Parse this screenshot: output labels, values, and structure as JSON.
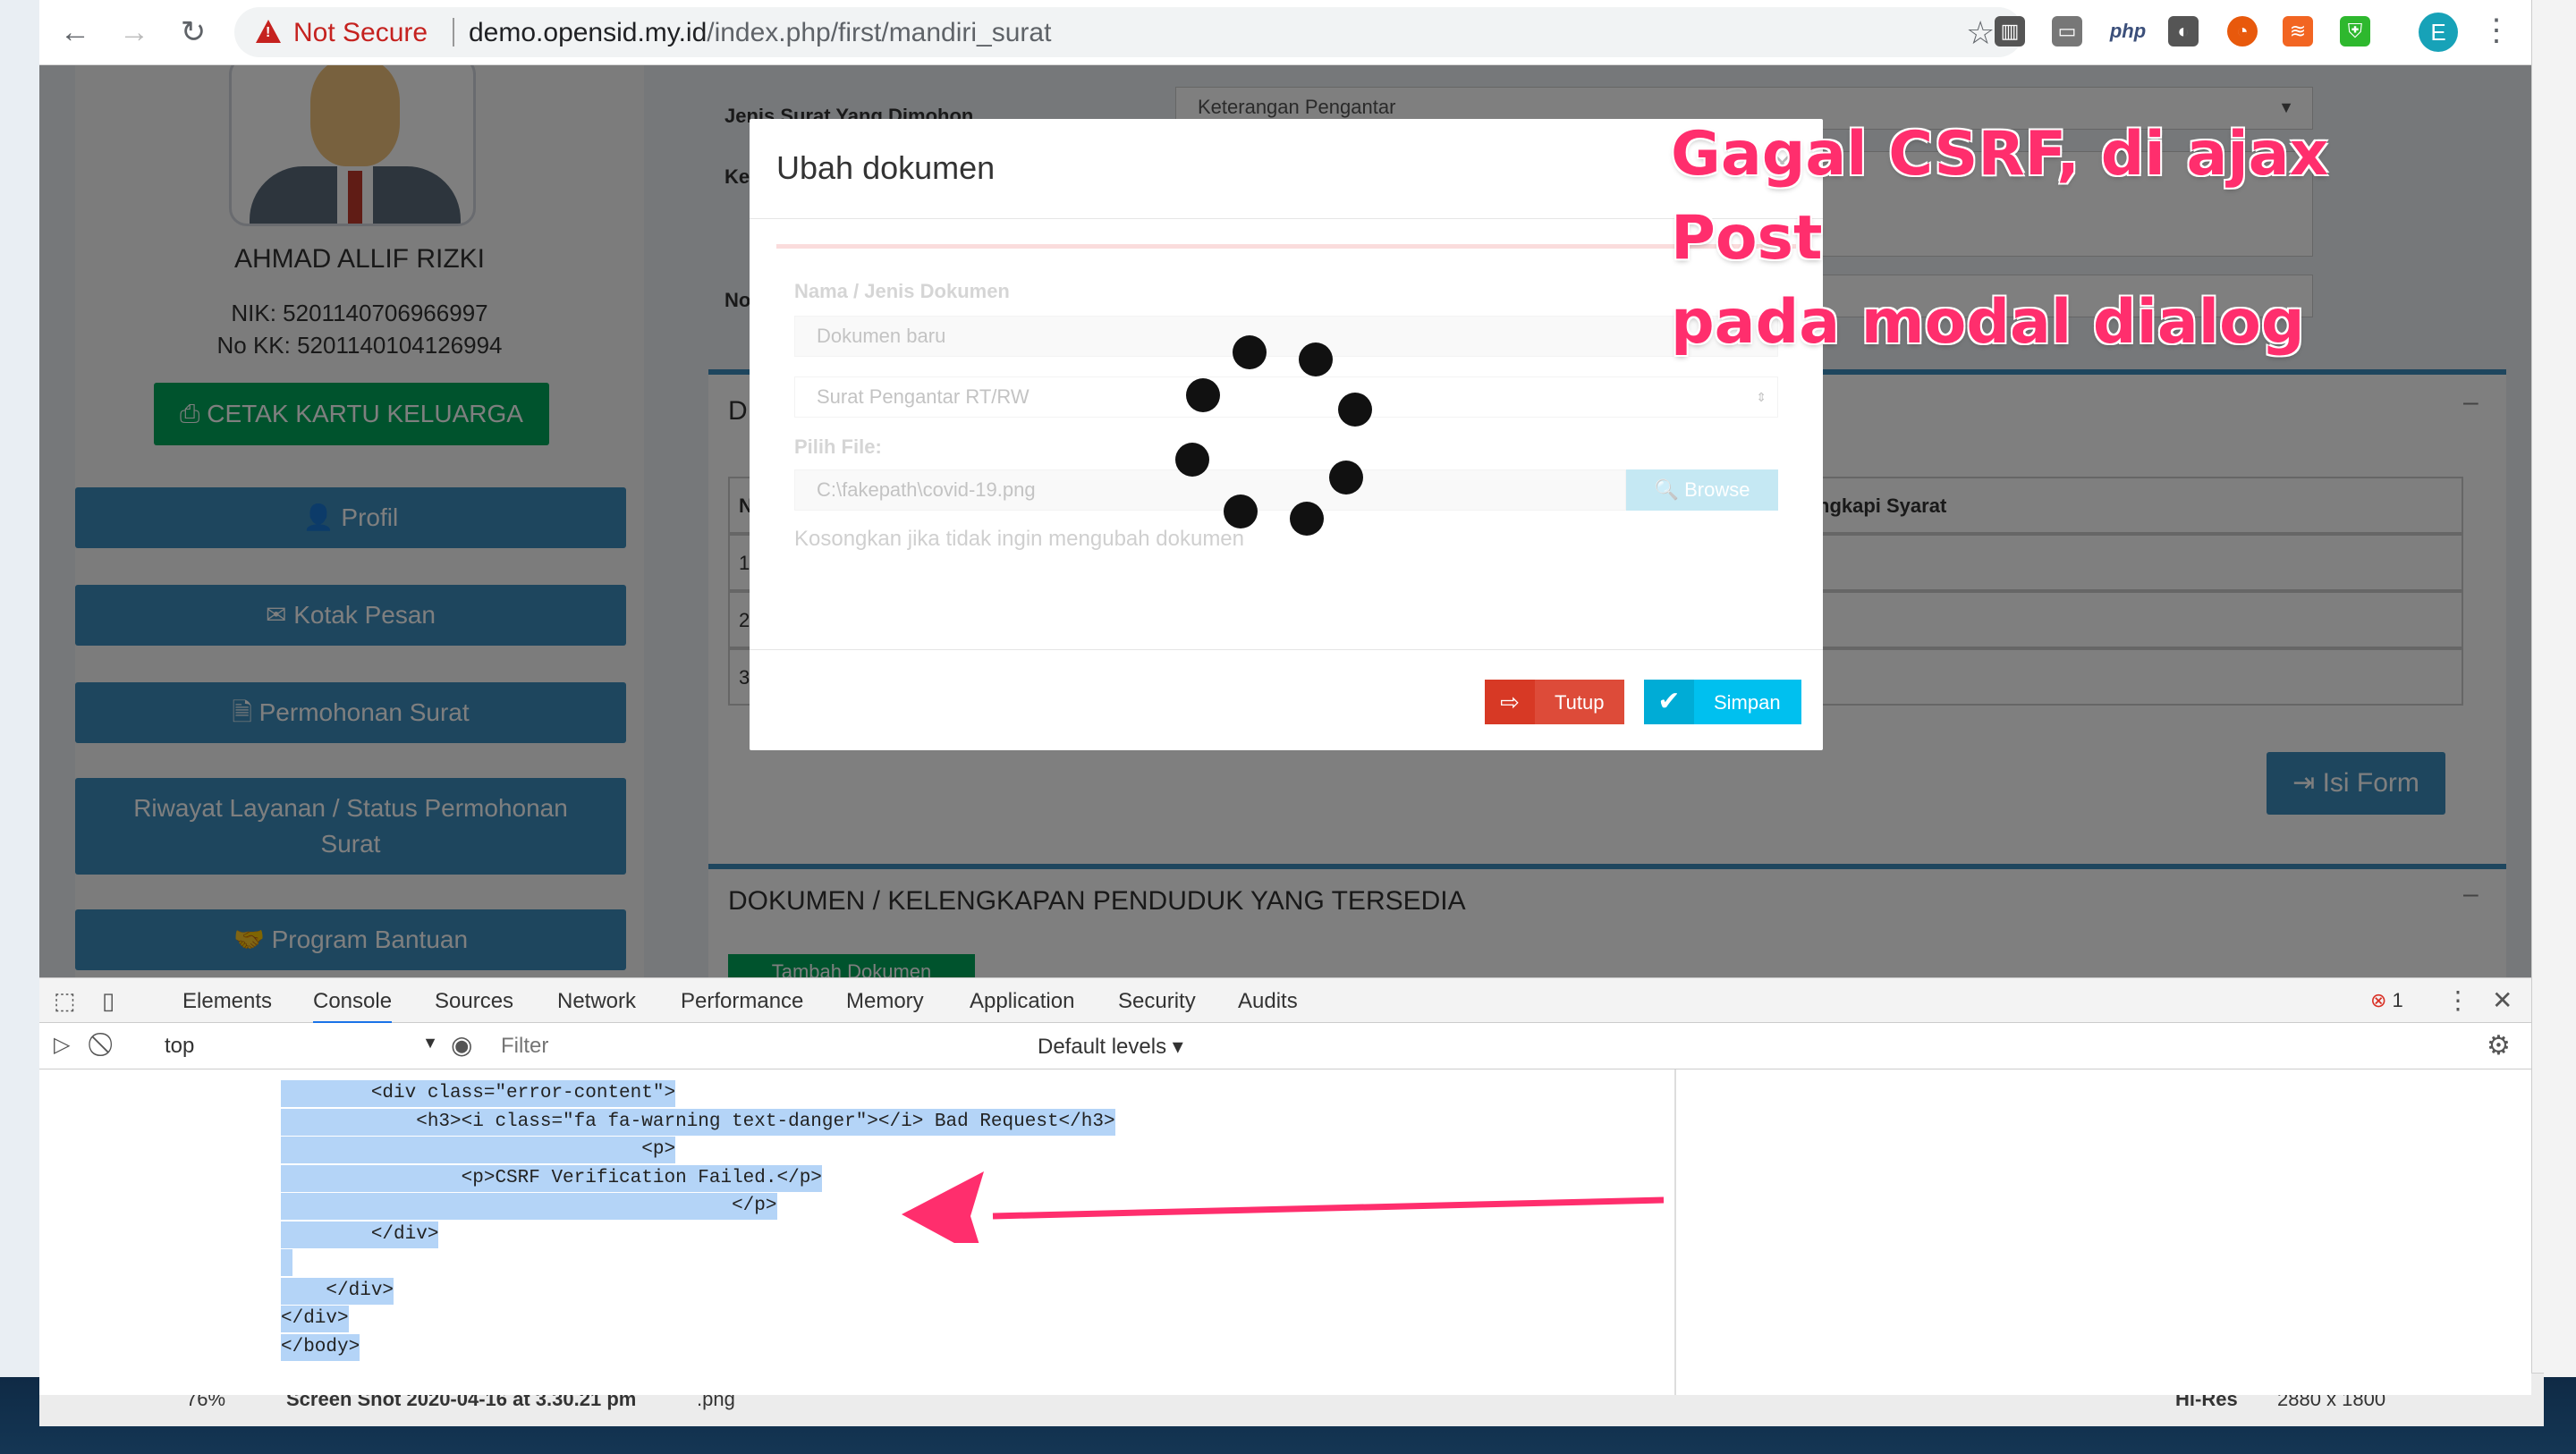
{
  "browser": {
    "security_label": "Not Secure",
    "url_domain": "demo.opensid.my.id",
    "url_path": "/index.php/first/mandiri_surat",
    "avatar_letter": "E",
    "ext_php": "php"
  },
  "sidebar": {
    "user_name": "AHMAD ALLIF RIZKI",
    "nik": "NIK: 5201140706966997",
    "no_kk": "No KK: 5201140104126994",
    "cetak_label": "CETAK KARTU KELUARGA",
    "menu": [
      {
        "label": "Profil",
        "icon": "user-icon"
      },
      {
        "label": "Kotak Pesan",
        "icon": "envelope-icon"
      },
      {
        "label": "Permohonan Surat",
        "icon": "file-icon"
      },
      {
        "label": "Riwayat Layanan / Status Permohonan Surat",
        "icon": "history-icon"
      },
      {
        "label": "Program Bantuan",
        "icon": "handshake-icon"
      }
    ]
  },
  "main": {
    "jenis_label": "Jenis Surat Yang Dimohon",
    "jenis_value": "Keterangan Pengantar",
    "ket_label": "Ke",
    "no_label": "No",
    "box1_title": "D",
    "table_header_right": "ngkapi Syarat",
    "table_header_left": "N",
    "row_nums": [
      "1",
      "2",
      "3"
    ],
    "isi_form_label": "Isi Form",
    "box2_title": "DOKUMEN / KELENGKAPAN PENDUDUK YANG TERSEDIA",
    "tambah_label": "Tambah Dokumen",
    "collapse_label": "–"
  },
  "modal": {
    "title": "Ubah dokumen",
    "close": "×",
    "nama_label": "Nama / Jenis Dokumen",
    "nama_value": "Dokumen baru",
    "jenis_select": "Surat Pengantar RT/RW",
    "file_label": "Pilih File:",
    "file_value": "C:\\fakepath\\covid-19.png",
    "browse_label": "Browse",
    "hint": "Kosongkan jika tidak ingin mengubah dokumen",
    "tutup_label": "Tutup",
    "simpan_label": "Simpan"
  },
  "devtools": {
    "tabs": [
      "Elements",
      "Console",
      "Sources",
      "Network",
      "Performance",
      "Memory",
      "Application",
      "Security",
      "Audits"
    ],
    "active_tab": "Console",
    "error_count": "1",
    "context": "top",
    "filter_placeholder": "Filter",
    "levels": "Default levels",
    "code_lines": [
      "        <div class=\"error-content\">",
      "            <h3><i class=\"fa fa-warning text-danger\"></i> Bad Request</h3>",
      "                                <p>",
      "                <p>CSRF Verification Failed.</p>",
      "                                        </p>",
      "        </div>",
      "",
      "    </div>",
      "</div>",
      "</body>"
    ]
  },
  "annotation": {
    "line1": "Gagal CSRF, di ajax Post",
    "line2": "pada modal dialog",
    "color": "#ff2e6d"
  },
  "finder": {
    "zoom": "76%",
    "filename": "Screen Shot 2020-04-16 at 3.30.21 pm",
    "ext": ".png",
    "hires": "Hi-Res",
    "dims": "2880 x 1800"
  }
}
